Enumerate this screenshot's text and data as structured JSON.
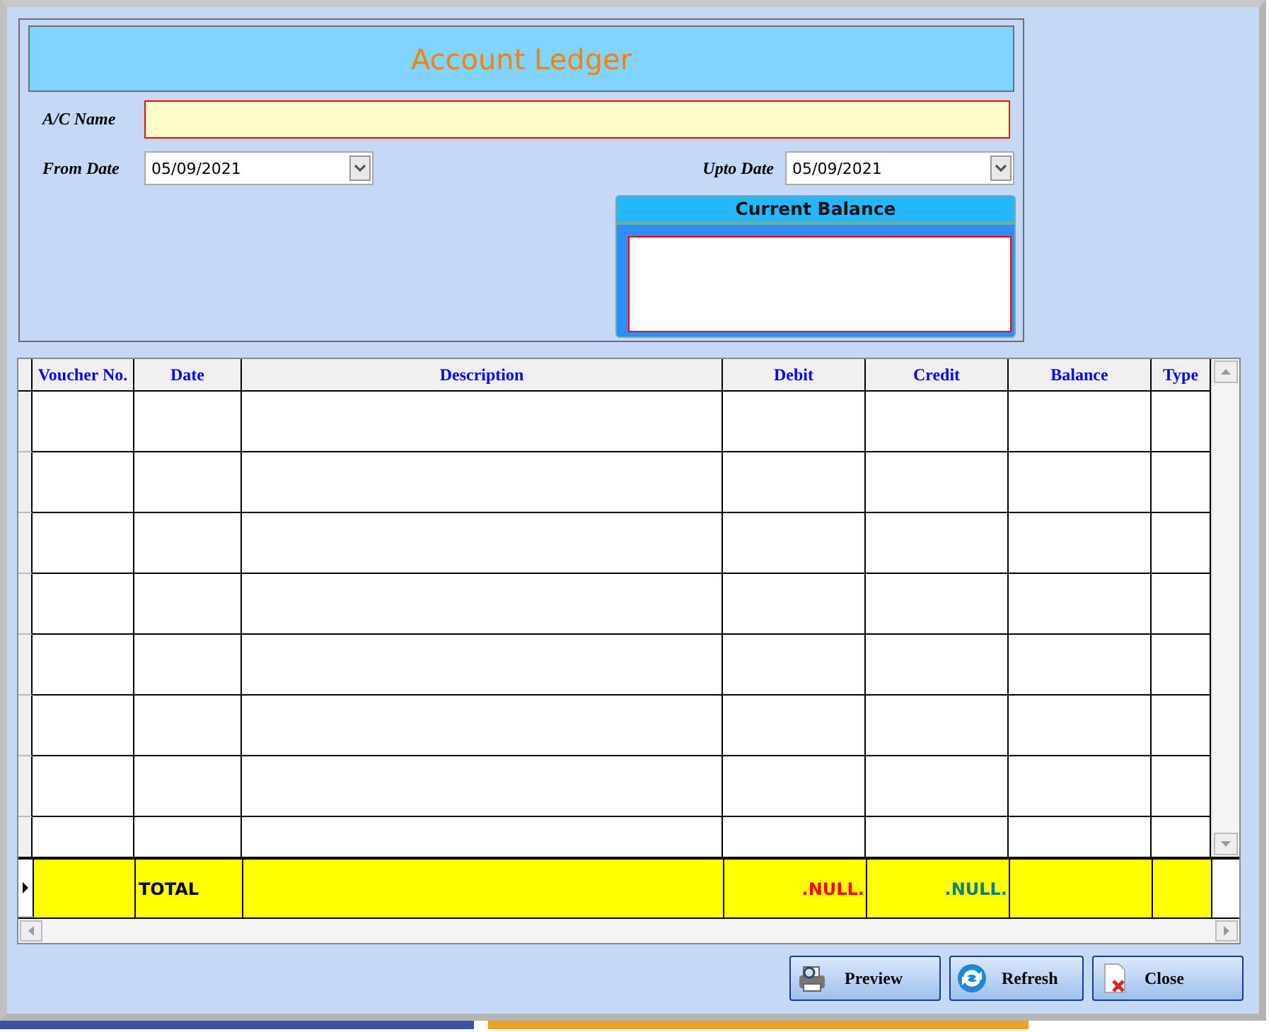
{
  "title": "Account Ledger",
  "fields": {
    "ac_name": {
      "label": "A/C Name"
    },
    "from_date": {
      "label": "From Date",
      "value": "05/09/2021"
    },
    "upto_date": {
      "label": "Upto Date",
      "value": "05/09/2021"
    }
  },
  "current_balance": {
    "title": "Current Balance"
  },
  "table": {
    "columns": [
      "Voucher No.",
      "Date",
      "Description",
      "Debit",
      "Credit",
      "Balance",
      "Type"
    ],
    "total_row": {
      "label": "TOTAL",
      "debit": ".NULL.",
      "credit": ".NULL."
    }
  },
  "buttons": [
    {
      "label": "Preview",
      "kind": "preview"
    },
    {
      "label": "Refresh",
      "kind": "refresh"
    },
    {
      "label": "Close",
      "kind": "close"
    }
  ]
}
